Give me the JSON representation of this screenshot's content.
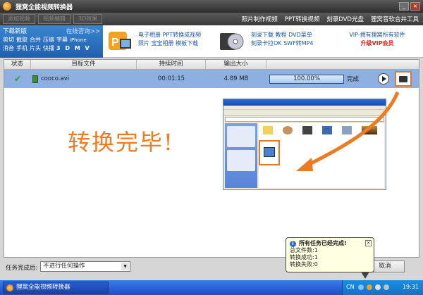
{
  "window": {
    "title": "狸窝全能视频转换器"
  },
  "toolbar": {
    "buttons": [
      "添加视频",
      "视频编辑",
      "3D效果"
    ],
    "links": [
      "照片制作视频",
      "PPT转换视频",
      "刻录DVD光盘",
      "狸窝音软合并工具"
    ]
  },
  "banner": {
    "left_title": "下载新版",
    "left_more": "在线咨询>>",
    "left_line1": [
      "剪切",
      "截取",
      "合并",
      "压缩",
      "字幕",
      "iPhone"
    ],
    "left_line2": [
      "消音",
      "手机",
      "片头",
      "快播",
      "3 D  M V"
    ],
    "mid_line1": "电子相册 PPT转换成视频",
    "mid_line2": "照片 宝宝相册 模板下载",
    "dvd_line1": "刻录下载 教程 DVD菜单",
    "dvd_line2": "刻录卡拉OK SWF转MP4",
    "vip_line1": "VIP-拥有狸窝所有软件",
    "vip_line2": "升级VIP会员"
  },
  "table": {
    "headers": [
      "状态",
      "目标文件",
      "持续时间",
      "输出大小"
    ],
    "rows": [
      {
        "file": "cooco.avi",
        "duration": "00:01:15",
        "size": "4.89 MB",
        "progress": "100.00%",
        "progress_value": 1.0,
        "status": "完成"
      }
    ]
  },
  "done_message": "转换完毕!",
  "bottom": {
    "after_label": "任务完成后:",
    "after_value": "不进行任何操作",
    "cancel": "取消"
  },
  "balloon": {
    "title": "所有任务已经完成!",
    "total": "总文件数:1",
    "success": "转换成功:1",
    "failed": "转换失败:0"
  },
  "taskbar": {
    "app": "狸窝全能视频转换器",
    "lang": "CN",
    "clock": "19:31"
  },
  "colors": {
    "accent_orange": "#ee7a22",
    "row_highlight": "#8db0e0",
    "taskbar_blue": "#2456d0"
  }
}
